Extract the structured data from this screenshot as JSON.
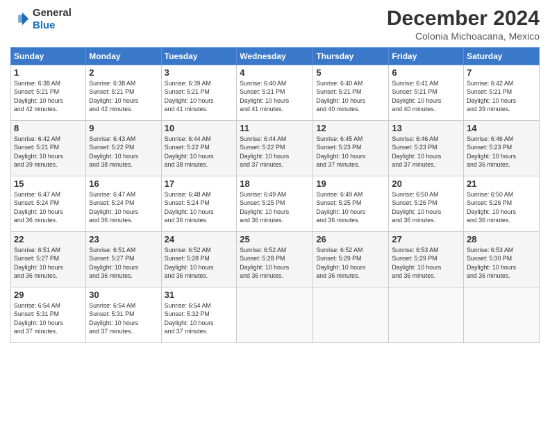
{
  "header": {
    "logo_general": "General",
    "logo_blue": "Blue",
    "month_year": "December 2024",
    "location": "Colonia Michoacana, Mexico"
  },
  "weekdays": [
    "Sunday",
    "Monday",
    "Tuesday",
    "Wednesday",
    "Thursday",
    "Friday",
    "Saturday"
  ],
  "weeks": [
    [
      {
        "day": "1",
        "info": "Sunrise: 6:38 AM\nSunset: 5:21 PM\nDaylight: 10 hours\nand 42 minutes."
      },
      {
        "day": "2",
        "info": "Sunrise: 6:38 AM\nSunset: 5:21 PM\nDaylight: 10 hours\nand 42 minutes."
      },
      {
        "day": "3",
        "info": "Sunrise: 6:39 AM\nSunset: 5:21 PM\nDaylight: 10 hours\nand 41 minutes."
      },
      {
        "day": "4",
        "info": "Sunrise: 6:40 AM\nSunset: 5:21 PM\nDaylight: 10 hours\nand 41 minutes."
      },
      {
        "day": "5",
        "info": "Sunrise: 6:40 AM\nSunset: 5:21 PM\nDaylight: 10 hours\nand 40 minutes."
      },
      {
        "day": "6",
        "info": "Sunrise: 6:41 AM\nSunset: 5:21 PM\nDaylight: 10 hours\nand 40 minutes."
      },
      {
        "day": "7",
        "info": "Sunrise: 6:42 AM\nSunset: 5:21 PM\nDaylight: 10 hours\nand 39 minutes."
      }
    ],
    [
      {
        "day": "8",
        "info": "Sunrise: 6:42 AM\nSunset: 5:21 PM\nDaylight: 10 hours\nand 39 minutes."
      },
      {
        "day": "9",
        "info": "Sunrise: 6:43 AM\nSunset: 5:22 PM\nDaylight: 10 hours\nand 38 minutes."
      },
      {
        "day": "10",
        "info": "Sunrise: 6:44 AM\nSunset: 5:22 PM\nDaylight: 10 hours\nand 38 minutes."
      },
      {
        "day": "11",
        "info": "Sunrise: 6:44 AM\nSunset: 5:22 PM\nDaylight: 10 hours\nand 37 minutes."
      },
      {
        "day": "12",
        "info": "Sunrise: 6:45 AM\nSunset: 5:23 PM\nDaylight: 10 hours\nand 37 minutes."
      },
      {
        "day": "13",
        "info": "Sunrise: 6:46 AM\nSunset: 5:23 PM\nDaylight: 10 hours\nand 37 minutes."
      },
      {
        "day": "14",
        "info": "Sunrise: 6:46 AM\nSunset: 5:23 PM\nDaylight: 10 hours\nand 36 minutes."
      }
    ],
    [
      {
        "day": "15",
        "info": "Sunrise: 6:47 AM\nSunset: 5:24 PM\nDaylight: 10 hours\nand 36 minutes."
      },
      {
        "day": "16",
        "info": "Sunrise: 6:47 AM\nSunset: 5:24 PM\nDaylight: 10 hours\nand 36 minutes."
      },
      {
        "day": "17",
        "info": "Sunrise: 6:48 AM\nSunset: 5:24 PM\nDaylight: 10 hours\nand 36 minutes."
      },
      {
        "day": "18",
        "info": "Sunrise: 6:49 AM\nSunset: 5:25 PM\nDaylight: 10 hours\nand 36 minutes."
      },
      {
        "day": "19",
        "info": "Sunrise: 6:49 AM\nSunset: 5:25 PM\nDaylight: 10 hours\nand 36 minutes."
      },
      {
        "day": "20",
        "info": "Sunrise: 6:50 AM\nSunset: 5:26 PM\nDaylight: 10 hours\nand 36 minutes."
      },
      {
        "day": "21",
        "info": "Sunrise: 6:50 AM\nSunset: 5:26 PM\nDaylight: 10 hours\nand 36 minutes."
      }
    ],
    [
      {
        "day": "22",
        "info": "Sunrise: 6:51 AM\nSunset: 5:27 PM\nDaylight: 10 hours\nand 36 minutes."
      },
      {
        "day": "23",
        "info": "Sunrise: 6:51 AM\nSunset: 5:27 PM\nDaylight: 10 hours\nand 36 minutes."
      },
      {
        "day": "24",
        "info": "Sunrise: 6:52 AM\nSunset: 5:28 PM\nDaylight: 10 hours\nand 36 minutes."
      },
      {
        "day": "25",
        "info": "Sunrise: 6:52 AM\nSunset: 5:28 PM\nDaylight: 10 hours\nand 36 minutes."
      },
      {
        "day": "26",
        "info": "Sunrise: 6:52 AM\nSunset: 5:29 PM\nDaylight: 10 hours\nand 36 minutes."
      },
      {
        "day": "27",
        "info": "Sunrise: 6:53 AM\nSunset: 5:29 PM\nDaylight: 10 hours\nand 36 minutes."
      },
      {
        "day": "28",
        "info": "Sunrise: 6:53 AM\nSunset: 5:30 PM\nDaylight: 10 hours\nand 36 minutes."
      }
    ],
    [
      {
        "day": "29",
        "info": "Sunrise: 6:54 AM\nSunset: 5:31 PM\nDaylight: 10 hours\nand 37 minutes."
      },
      {
        "day": "30",
        "info": "Sunrise: 6:54 AM\nSunset: 5:31 PM\nDaylight: 10 hours\nand 37 minutes."
      },
      {
        "day": "31",
        "info": "Sunrise: 6:54 AM\nSunset: 5:32 PM\nDaylight: 10 hours\nand 37 minutes."
      },
      {
        "day": "",
        "info": ""
      },
      {
        "day": "",
        "info": ""
      },
      {
        "day": "",
        "info": ""
      },
      {
        "day": "",
        "info": ""
      }
    ]
  ]
}
